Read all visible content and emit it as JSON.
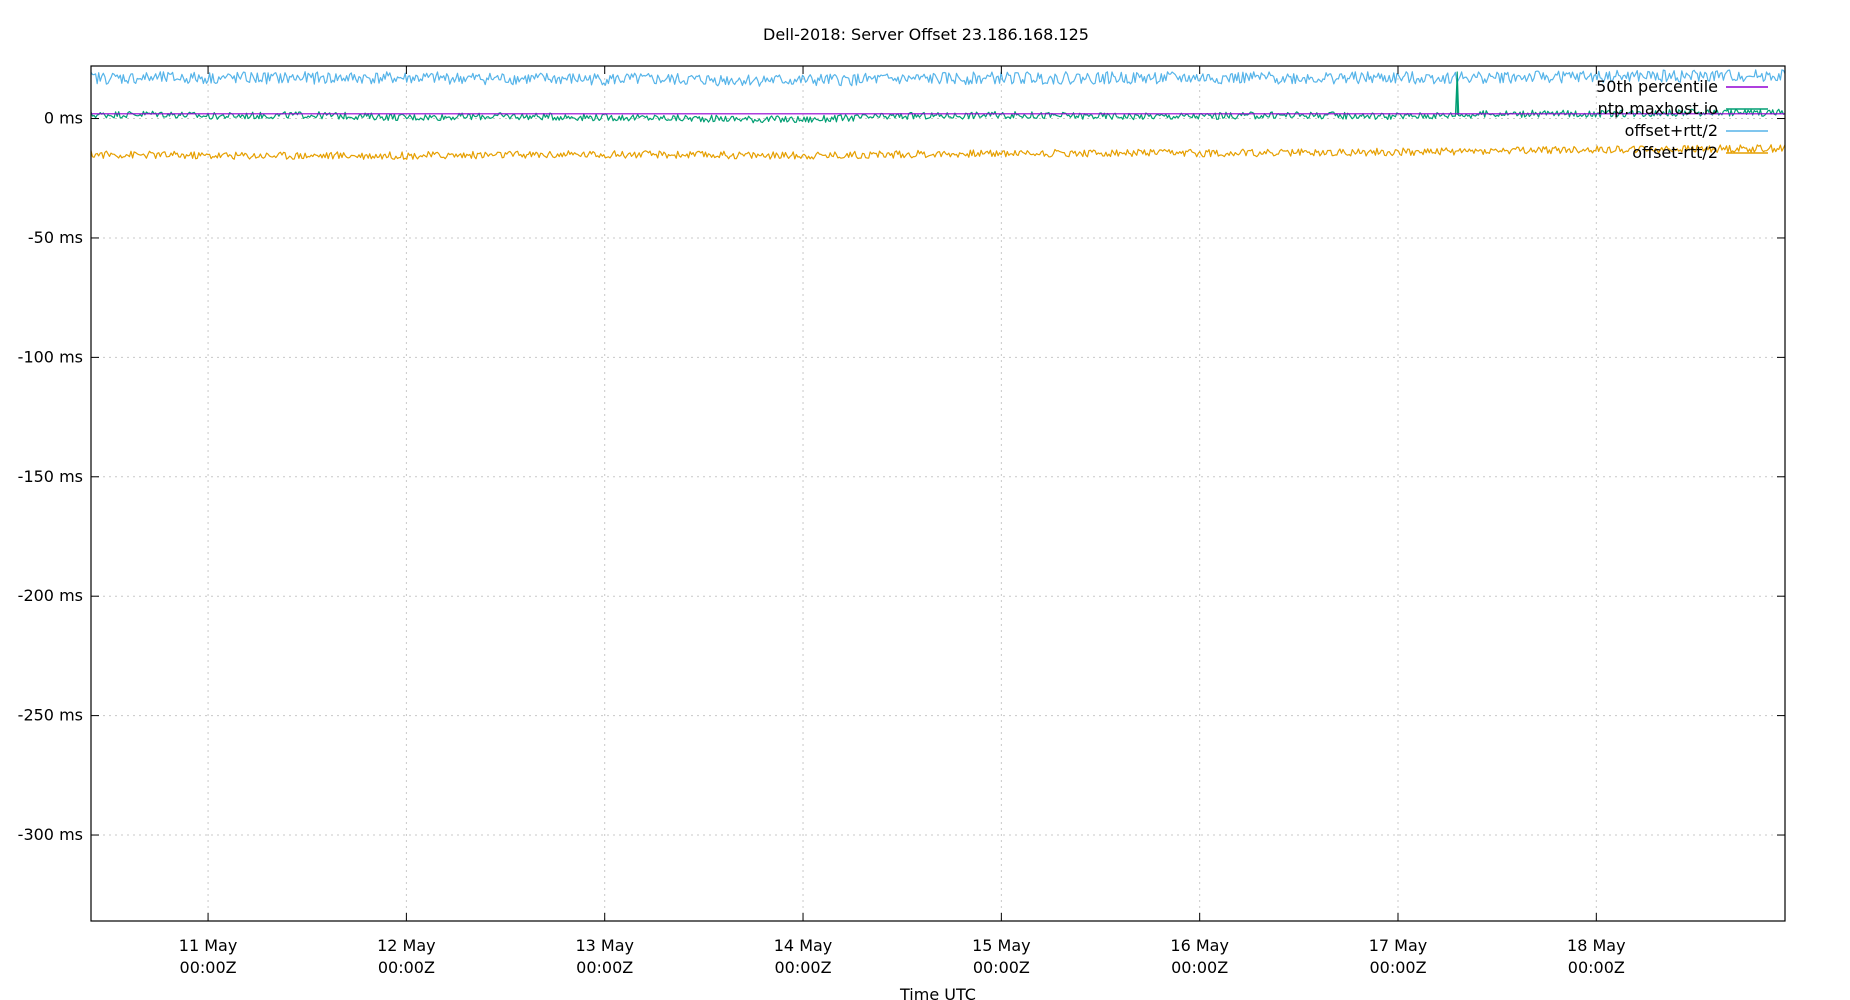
{
  "chart_data": {
    "type": "line",
    "title": "Dell-2018: Server Offset 23.186.168.125",
    "xlabel": "Time UTC",
    "ylabel": "",
    "ylim": [
      -336,
      22
    ],
    "y_ticks": [
      {
        "value": 0,
        "label": "0 ms"
      },
      {
        "value": -50,
        "label": "-50 ms"
      },
      {
        "value": -100,
        "label": "-100 ms"
      },
      {
        "value": -150,
        "label": "-150 ms"
      },
      {
        "value": -200,
        "label": "-200 ms"
      },
      {
        "value": -250,
        "label": "-250 ms"
      },
      {
        "value": -300,
        "label": "-300 ms"
      }
    ],
    "xlim": [
      "2018-05-10T09:50Z",
      "2018-05-18T22:50Z"
    ],
    "x_ticks": [
      {
        "value": "2018-05-11T00:00Z",
        "line1": "11 May",
        "line2": "00:00Z"
      },
      {
        "value": "2018-05-12T00:00Z",
        "line1": "12 May",
        "line2": "00:00Z"
      },
      {
        "value": "2018-05-13T00:00Z",
        "line1": "13 May",
        "line2": "00:00Z"
      },
      {
        "value": "2018-05-14T00:00Z",
        "line1": "14 May",
        "line2": "00:00Z"
      },
      {
        "value": "2018-05-15T00:00Z",
        "line1": "15 May",
        "line2": "00:00Z"
      },
      {
        "value": "2018-05-16T00:00Z",
        "line1": "16 May",
        "line2": "00:00Z"
      },
      {
        "value": "2018-05-17T00:00Z",
        "line1": "17 May",
        "line2": "00:00Z"
      },
      {
        "value": "2018-05-18T00:00Z",
        "line1": "18 May",
        "line2": "00:00Z"
      }
    ],
    "grid": true,
    "legend_position": "top-right",
    "series": [
      {
        "name": "50th percentile",
        "color": "#9400d3",
        "x": [
          "2018-05-10T09:50Z",
          "2018-05-18T22:50Z"
        ],
        "y": [
          2.0,
          2.0
        ]
      },
      {
        "name": "ntp.maxhost.io",
        "color": "#009e73",
        "x": [
          "2018-05-10T09:50Z",
          "2018-05-10T18:00Z",
          "2018-05-11T00:00Z",
          "2018-05-11T12:00Z",
          "2018-05-12T00:00Z",
          "2018-05-12T12:00Z",
          "2018-05-13T00:00Z",
          "2018-05-13T12:00Z",
          "2018-05-14T00:00Z",
          "2018-05-14T12:00Z",
          "2018-05-15T00:00Z",
          "2018-05-15T12:00Z",
          "2018-05-16T00:00Z",
          "2018-05-16T12:00Z",
          "2018-05-17T00:00Z",
          "2018-05-17T07:00Z",
          "2018-05-17T07:10Z",
          "2018-05-17T07:20Z",
          "2018-05-17T12:00Z",
          "2018-05-18T00:00Z",
          "2018-05-18T12:00Z",
          "2018-05-18T22:50Z"
        ],
        "y": [
          1.5,
          2.0,
          1.0,
          1.5,
          0.5,
          1.0,
          0.5,
          0.0,
          -0.5,
          1.0,
          1.5,
          1.0,
          1.0,
          1.5,
          1.0,
          1.5,
          19.5,
          1.5,
          2.0,
          2.0,
          2.5,
          2.5
        ]
      },
      {
        "name": "offset+rtt/2",
        "color": "#56b4e9",
        "x": [
          "2018-05-10T09:50Z",
          "2018-05-11T00:00Z",
          "2018-05-12T00:00Z",
          "2018-05-13T00:00Z",
          "2018-05-14T00:00Z",
          "2018-05-15T00:00Z",
          "2018-05-16T00:00Z",
          "2018-05-17T00:00Z",
          "2018-05-18T00:00Z",
          "2018-05-18T22:50Z"
        ],
        "y": [
          17,
          17,
          17,
          16.5,
          16,
          17,
          17,
          17,
          17.5,
          18
        ]
      },
      {
        "name": "offset-rtt/2",
        "color": "#e69f00",
        "x": [
          "2018-05-10T09:50Z",
          "2018-05-11T00:00Z",
          "2018-05-12T00:00Z",
          "2018-05-13T00:00Z",
          "2018-05-14T00:00Z",
          "2018-05-15T00:00Z",
          "2018-05-16T00:00Z",
          "2018-05-17T00:00Z",
          "2018-05-18T00:00Z",
          "2018-05-18T22:50Z"
        ],
        "y": [
          -15,
          -15.5,
          -15.5,
          -15,
          -15.5,
          -14.5,
          -14.5,
          -14,
          -13,
          -12.5
        ]
      }
    ]
  }
}
